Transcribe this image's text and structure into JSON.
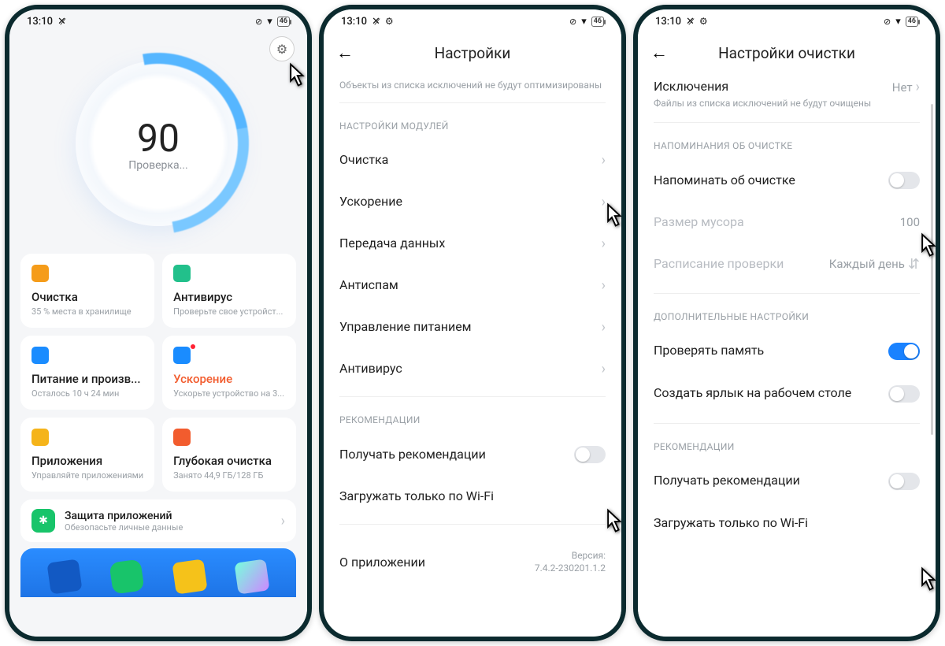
{
  "status": {
    "time": "13:10",
    "battery": "46"
  },
  "phone1": {
    "score": "90",
    "score_sub": "Проверка...",
    "tiles": [
      {
        "title": "Очистка",
        "sub": "35 % места в хранилище",
        "icon": "#f59c1a"
      },
      {
        "title": "Антивирус",
        "sub": "Проверьте свое устройст...",
        "icon": "#22c08b"
      },
      {
        "title": "Питание и произв...",
        "sub": "Осталось 10 ч 24 мин",
        "icon": "#1a8cff"
      },
      {
        "title": "Ускорение",
        "sub": "Ускорьте устройство на 3...",
        "icon": "#1a8cff",
        "warn": true,
        "dot": true
      },
      {
        "title": "Приложения",
        "sub": "Управляйте приложениями",
        "icon": "#f5b41a"
      },
      {
        "title": "Глубокая очистка",
        "sub": "Занято 44,9 ГБ/128 ГБ",
        "icon": "#f25c2e"
      }
    ],
    "protect": {
      "title": "Защита приложений",
      "sub": "Обезопасьте личные данные"
    }
  },
  "phone2": {
    "title": "Настройки",
    "top_note": "Объекты из списка исключений не будут оптимизированы",
    "section_modules": "НАСТРОЙКИ МОДУЛЕЙ",
    "items": [
      "Очистка",
      "Ускорение",
      "Передача данных",
      "Антиспам",
      "Управление питанием",
      "Антивирус"
    ],
    "section_reco": "РЕКОМЕНДАЦИИ",
    "reco1": "Получать рекомендации",
    "reco2": "Загружать только по Wi-Fi",
    "about": "О приложении",
    "version_label": "Версия:",
    "version": "7.4.2-230201.1.2"
  },
  "phone3": {
    "title": "Настройки очистки",
    "excl_title": "Исключения",
    "excl_sub": "Файлы из списка исключений не будут очищены",
    "excl_val": "Нет",
    "section_remind": "НАПОМИНАНИЯ ОБ ОЧИСТКЕ",
    "remind": "Напоминать об очистке",
    "trash_size_label": "Размер мусора",
    "trash_size_val": "100",
    "schedule_label": "Расписание проверки",
    "schedule_val": "Каждый день",
    "section_extra": "ДОПОЛНИТЕЛЬНЫЕ НАСТРОЙКИ",
    "check_mem": "Проверять память",
    "shortcut": "Создать ярлык на рабочем столе",
    "section_reco": "РЕКОМЕНДАЦИИ",
    "reco1": "Получать рекомендации",
    "reco2": "Загружать только по Wi-Fi"
  }
}
